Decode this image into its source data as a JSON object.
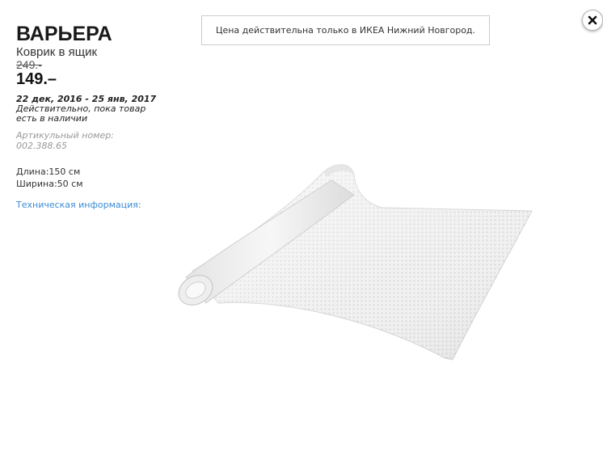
{
  "product": {
    "name": "ВАРЬЕРА",
    "type": "Коврик в ящик",
    "old_price": "249.-",
    "new_price": "149.–",
    "validity_dates": "22 дек, 2016 - 25 янв, 2017",
    "validity_note": " Действительно, пока товар есть в наличии",
    "article_label": "Артикульный номер:",
    "article_number": "002.388.65",
    "length": "Длина:150 см",
    "width": "Ширина:50 см",
    "tech_info_link": "Техническая информация:"
  },
  "notice": {
    "text": "Цена действительна только в ИКЕА Нижний Новгород."
  },
  "close_button": {
    "icon": "close-icon"
  },
  "image": {
    "subject": "rolled white drawer mat",
    "icon": "product-photo"
  }
}
